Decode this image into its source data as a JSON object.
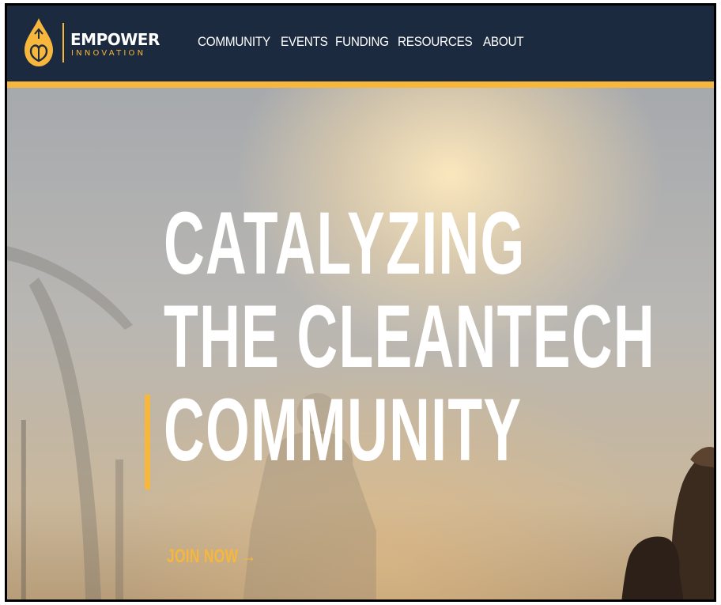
{
  "brand": {
    "name": "EMPOWER",
    "subtitle": "INNOVATION",
    "logo_icon": "drop-flame-icon",
    "colors": {
      "navy": "#1c2a3f",
      "gold": "#f6b73c",
      "white": "#ffffff"
    }
  },
  "nav": {
    "items": [
      {
        "label": "COMMUNITY"
      },
      {
        "label": "EVENTS"
      },
      {
        "label": "FUNDING"
      },
      {
        "label": "RESOURCES"
      },
      {
        "label": "ABOUT"
      }
    ]
  },
  "hero": {
    "lines": [
      "CATALYZING",
      "THE CLEANTECH",
      "COMMUNITY"
    ],
    "cta": "JOIN NOW →"
  }
}
